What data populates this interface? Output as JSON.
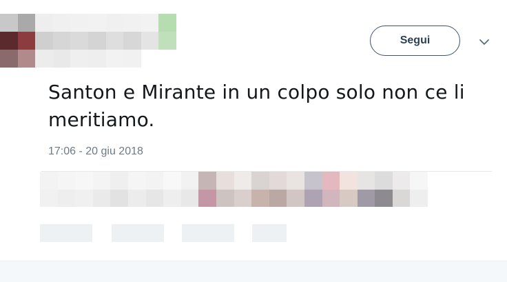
{
  "author": {
    "redacted": true,
    "pixel_colors": [
      [
        "#c8c8c8",
        "#a9a9a9",
        "#eeeeee",
        "#f0f0f0",
        "#f1f1f1",
        "#f2f2f2",
        "#f0f0f0",
        "#f1f1f1",
        "#f2f2f2",
        "#b6ddb0"
      ],
      [
        "#5b2a2c",
        "#8c3b3e",
        "#cfcfcf",
        "#d6d6d6",
        "#dadada",
        "#d4d4d4",
        "#dedede",
        "#d7d7d7",
        "#e4e4e4",
        "#bfe0bb"
      ],
      [
        "#8a6a6c",
        "#b18a8c",
        "#ececec",
        "#e9e9e9",
        "#efefef",
        "#eeeeee",
        "#f2f2f2",
        "#f1f1f1",
        "#ffffff",
        "#ffffff"
      ]
    ]
  },
  "follow_button": {
    "label": "Segui"
  },
  "tweet": {
    "text": "Santon e Mirante in un colpo solo non ce li meritiamo.",
    "timestamp": "17:06 - 20 giu 2018"
  },
  "stats": {
    "redacted": true,
    "pixel_colors": [
      [
        "#f3f3f3",
        "#f5f5f5",
        "#f7f7f7",
        "#f4f4f4",
        "#efefef",
        "#f5f5f5",
        "#f3f3f3",
        "#f8f8f8",
        "#f2f2f2",
        "#c5b5b4",
        "#e6dfdc",
        "#efebe8",
        "#d9d3d1",
        "#e2dad8",
        "#e9e4e2",
        "#c6c3cc",
        "#e3b8bf",
        "#f3e3df",
        "#e7e4e4",
        "#dcdcdc",
        "#eceaea",
        "#f6f6f6"
      ],
      [
        "#f1f1f1",
        "#eeeeee",
        "#f0f0f0",
        "#eaeaea",
        "#e2e2e2",
        "#ececec",
        "#e6e6e6",
        "#eeeeee",
        "#e8e8e8",
        "#c596a6",
        "#cdc4c2",
        "#d9cfcc",
        "#c8b3ac",
        "#b9a8a4",
        "#d2c6c4",
        "#ada3b3",
        "#d1b6be",
        "#d6cac2",
        "#a09aa7",
        "#8e8b90",
        "#dad7d7",
        "#eeeeee"
      ]
    ]
  },
  "actions": {
    "redacted": true,
    "color": "#eef1f4"
  },
  "icons": {
    "more": "chevron-down-icon"
  },
  "colors": {
    "text_primary": "#14171a",
    "text_secondary": "#6c7a86",
    "button_border": "#3d5466",
    "divider": "#e4e9ec"
  }
}
